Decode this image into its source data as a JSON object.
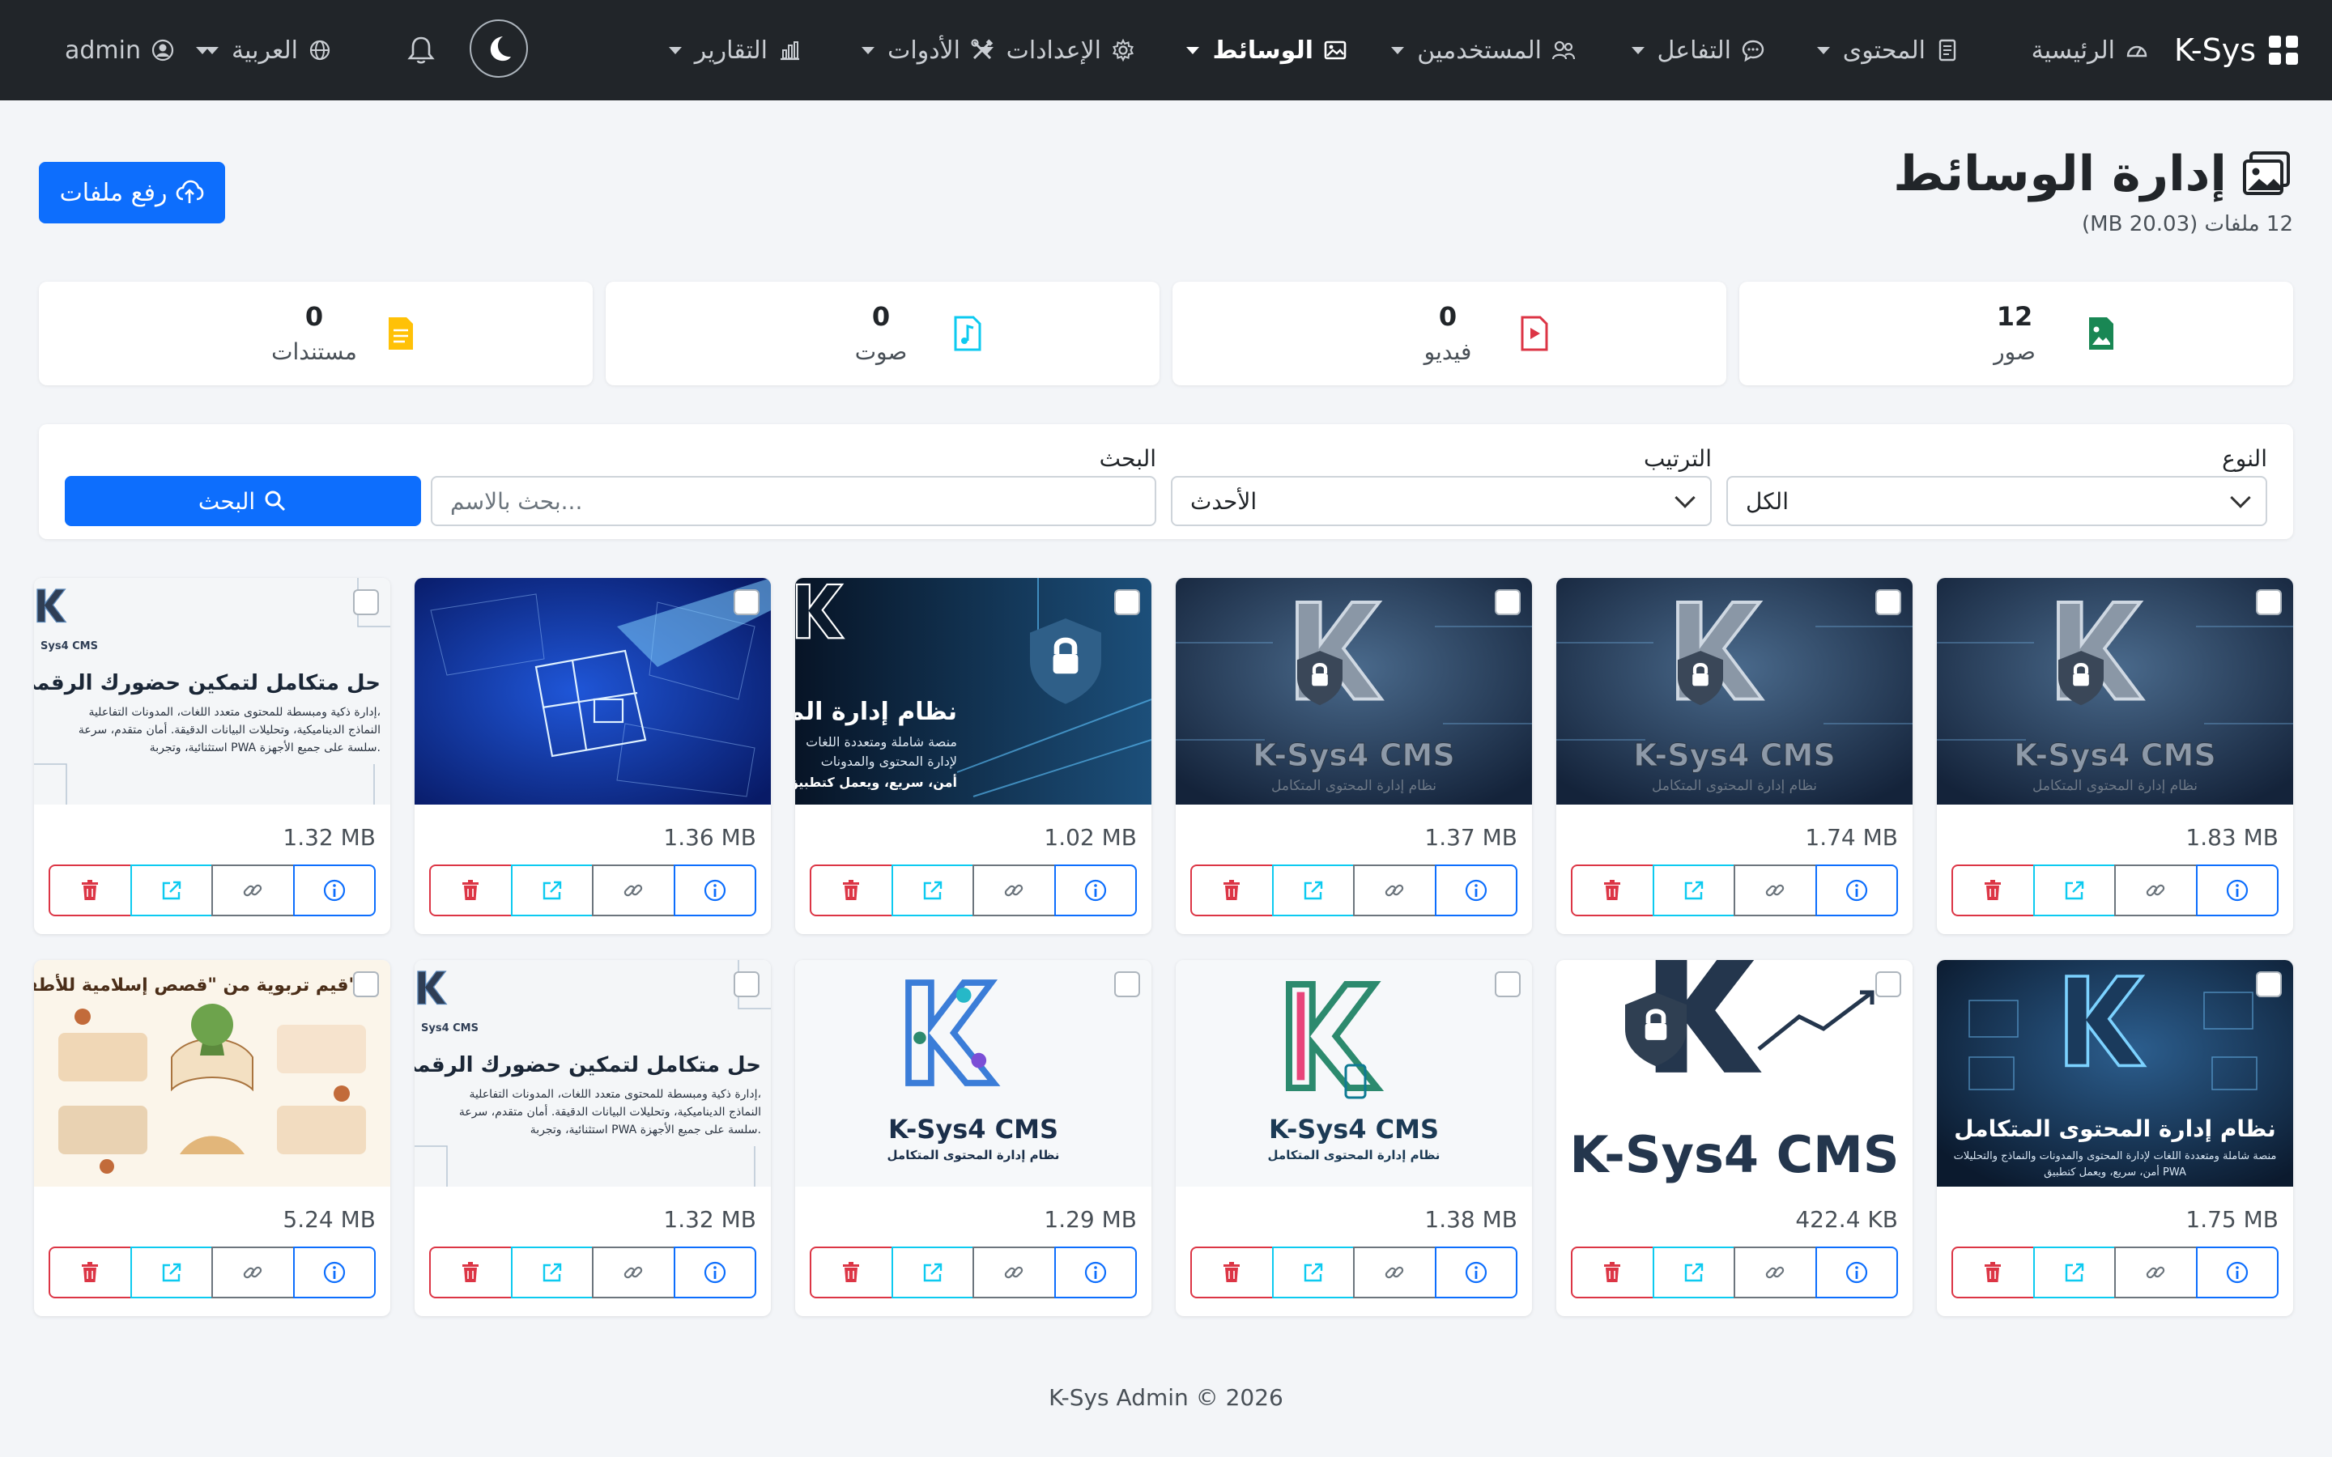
{
  "nav": {
    "brand": "K-Sys",
    "items": [
      {
        "label": "الرئيسية",
        "icon": "dashboard-icon"
      },
      {
        "label": "المحتوى",
        "icon": "document-icon"
      },
      {
        "label": "التفاعل",
        "icon": "chat-icon"
      },
      {
        "label": "المستخدمين",
        "icon": "users-icon"
      },
      {
        "label": "الوسائط",
        "icon": "image-icon"
      },
      {
        "label": "الإعدادات",
        "icon": "gear-icon"
      },
      {
        "label": "الأدوات",
        "icon": "tools-icon"
      },
      {
        "label": "التقارير",
        "icon": "bar-chart-icon"
      }
    ],
    "active": "الوسائط",
    "language": "العربية",
    "user": "admin"
  },
  "header": {
    "title": "إدارة الوسائط",
    "subtitle": "12 ملفات (20.03 MB)",
    "upload_label": "رفع ملفات"
  },
  "stats": [
    {
      "label": "صور",
      "value": "12",
      "color": "#198754",
      "icon": "image-file-icon"
    },
    {
      "label": "فيديو",
      "value": "0",
      "color": "#dc3545",
      "icon": "video-file-icon"
    },
    {
      "label": "صوت",
      "value": "0",
      "color": "#0dcaf0",
      "icon": "audio-file-icon"
    },
    {
      "label": "مستندات",
      "value": "0",
      "color": "#ffc107",
      "icon": "document-file-icon"
    }
  ],
  "filters": {
    "type_label": "النوع",
    "type_value": "الكل",
    "sort_label": "الترتيب",
    "sort_value": "الأحدث",
    "search_label": "البحث",
    "search_placeholder": "بحث بالاسم...",
    "search_button": "البحث"
  },
  "media": [
    {
      "size": "1.83 MB",
      "thumb": "ksys-dark-cms",
      "caption": "K-Sys4 CMS"
    },
    {
      "size": "1.74 MB",
      "thumb": "ksys-dark-cms",
      "caption": "K-Sys4 CMS"
    },
    {
      "size": "1.37 MB",
      "thumb": "ksys-dark-cms",
      "caption": "K-Sys4 CMS"
    },
    {
      "size": "1.02 MB",
      "thumb": "ksys-content-banner",
      "caption": "نظام إدارة المحتوى"
    },
    {
      "size": "1.36 MB",
      "thumb": "blueprint",
      "caption": ""
    },
    {
      "size": "1.32 MB",
      "thumb": "ksys-light-banner",
      "caption": "حل متكامل لتمكين حضورك الرقمي"
    },
    {
      "size": "1.75 MB",
      "thumb": "ksys-dark-cms2",
      "caption": "نظام إدارة المحتوى المتكامل"
    },
    {
      "size": "422.4 KB",
      "thumb": "ksys-logo-white",
      "caption": "K-Sys4 CMS"
    },
    {
      "size": "1.38 MB",
      "thumb": "ksys-logo-color",
      "caption": "K-Sys4 CMS"
    },
    {
      "size": "1.29 MB",
      "thumb": "ksys-logo-color2",
      "caption": "K-Sys4 CMS"
    },
    {
      "size": "1.32 MB",
      "thumb": "ksys-light-banner",
      "caption": "حل متكامل لتمكين حضورك الرقمي"
    },
    {
      "size": "5.24 MB",
      "thumb": "kids-stories",
      "caption": "قيم تربوية من \"قصص إسلامية للأطفال\""
    }
  ],
  "footer": "K-Sys Admin © 2026"
}
